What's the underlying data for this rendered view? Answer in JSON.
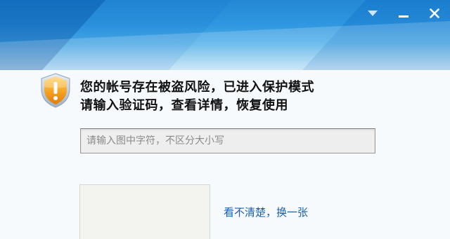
{
  "titlebar": {
    "menu_icon": "chevron-down-icon",
    "minimize_icon": "minimize-icon",
    "close_icon": "close-icon"
  },
  "alert": {
    "icon": "shield-warning-icon",
    "line1": "您的帐号存在被盗风险，已进入保护模式",
    "line2": "请输入验证码，查看详情，恢复使用"
  },
  "captcha": {
    "placeholder": "请输入图中字符，不区分大小写",
    "value": "",
    "refresh_label": "看不清楚，换一张"
  },
  "colors": {
    "title_gradient_top": "#1b7fd1",
    "title_gradient_bottom": "#f1f8fd",
    "shield_orange": "#f29a1b",
    "link_blue": "#1d5fa8"
  }
}
